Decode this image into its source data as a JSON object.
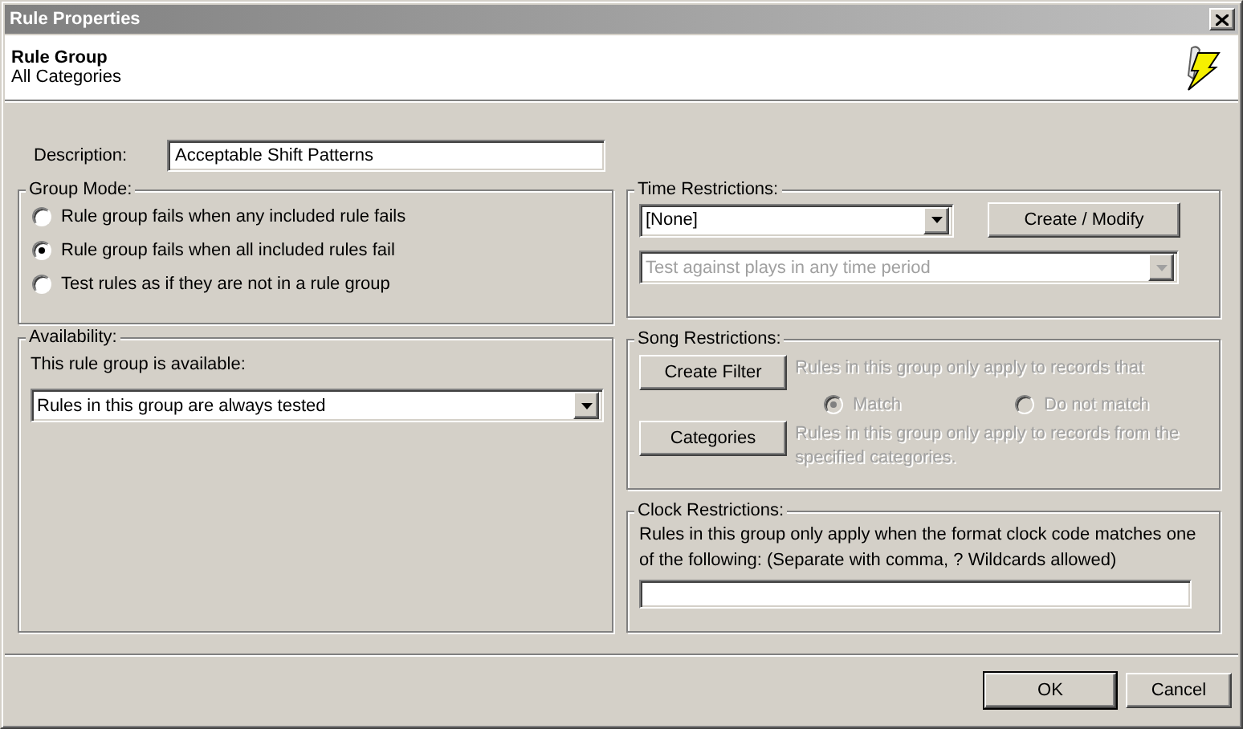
{
  "window": {
    "title": "Rule Properties"
  },
  "header": {
    "title": "Rule Group",
    "subtitle": "All Categories"
  },
  "description": {
    "label": "Description:",
    "value": "Acceptable Shift Patterns"
  },
  "group_mode": {
    "title": "Group Mode:",
    "options": [
      {
        "label": "Rule group fails when any included rule fails",
        "selected": false
      },
      {
        "label": "Rule group fails when all included rules fail",
        "selected": true
      },
      {
        "label": "Test rules as if they are not in a rule group",
        "selected": false
      }
    ]
  },
  "availability": {
    "title": "Availability:",
    "label": "This rule group is available:",
    "value": "Rules in this group are always tested"
  },
  "time_restrictions": {
    "title": "Time Restrictions:",
    "schedule": {
      "value": "[None]",
      "disabled": false
    },
    "button": "Create / Modify",
    "period": {
      "value": "Test against plays in any time period",
      "disabled": true
    }
  },
  "song_restrictions": {
    "title": "Song Restrictions:",
    "filter_button": "Create Filter",
    "filter_text": "Rules in this group only apply to records that",
    "match_options": [
      {
        "label": "Match",
        "selected": true,
        "disabled": true
      },
      {
        "label": "Do not match",
        "selected": false,
        "disabled": true
      }
    ],
    "categories_button": "Categories",
    "categories_text": "Rules in this group only apply to records from the specified categories."
  },
  "clock_restrictions": {
    "title": "Clock Restrictions:",
    "text": "Rules in this group only apply when the format clock code matches one of the following: (Separate with comma, ? Wildcards allowed)"
  },
  "buttons": [
    {
      "label": "OK",
      "default": true
    },
    {
      "label": "Cancel",
      "default": false
    }
  ]
}
